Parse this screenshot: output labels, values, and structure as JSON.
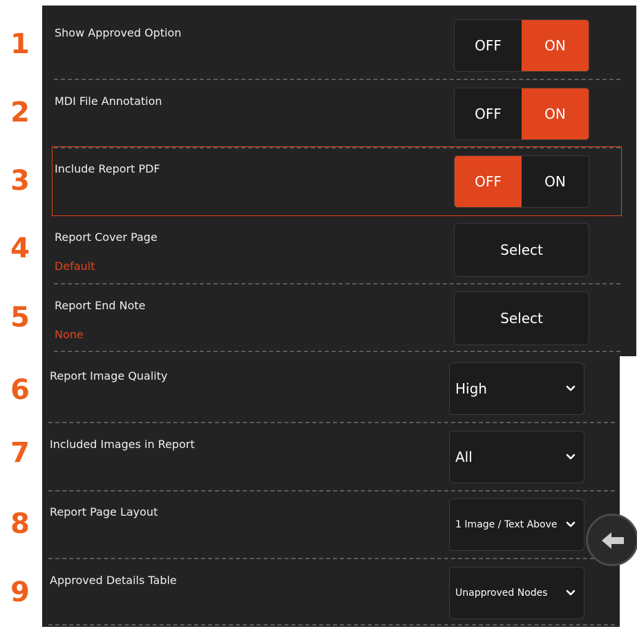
{
  "row_numbers": [
    "1",
    "2",
    "3",
    "4",
    "5",
    "6",
    "7",
    "8",
    "9"
  ],
  "settings": {
    "show_approved_option": {
      "label": "Show Approved Option",
      "off": "OFF",
      "on": "ON",
      "selected": "ON"
    },
    "mdi_file_annotation": {
      "label": "MDI File Annotation",
      "off": "OFF",
      "on": "ON",
      "selected": "ON"
    },
    "include_report_pdf": {
      "label": "Include Report PDF",
      "off": "OFF",
      "on": "ON",
      "selected": "OFF"
    },
    "report_cover_page": {
      "label": "Report Cover Page",
      "value": "Default",
      "button": "Select"
    },
    "report_end_note": {
      "label": "Report End Note",
      "value": "None",
      "button": "Select"
    },
    "report_image_quality": {
      "label": "Report Image Quality",
      "value": "High"
    },
    "included_images": {
      "label": "Included Images in Report",
      "value": "All"
    },
    "report_page_layout": {
      "label": "Report Page Layout",
      "value": "1 Image / Text Above"
    },
    "approved_details_table": {
      "label": "Approved Details Table",
      "value": "Unapproved Nodes"
    }
  },
  "colors": {
    "accent": "#e0451e",
    "number": "#ee5f1b",
    "background": "#232323"
  },
  "icons": {
    "chevron": "chevron-down-icon",
    "back": "back-arrow-icon"
  }
}
